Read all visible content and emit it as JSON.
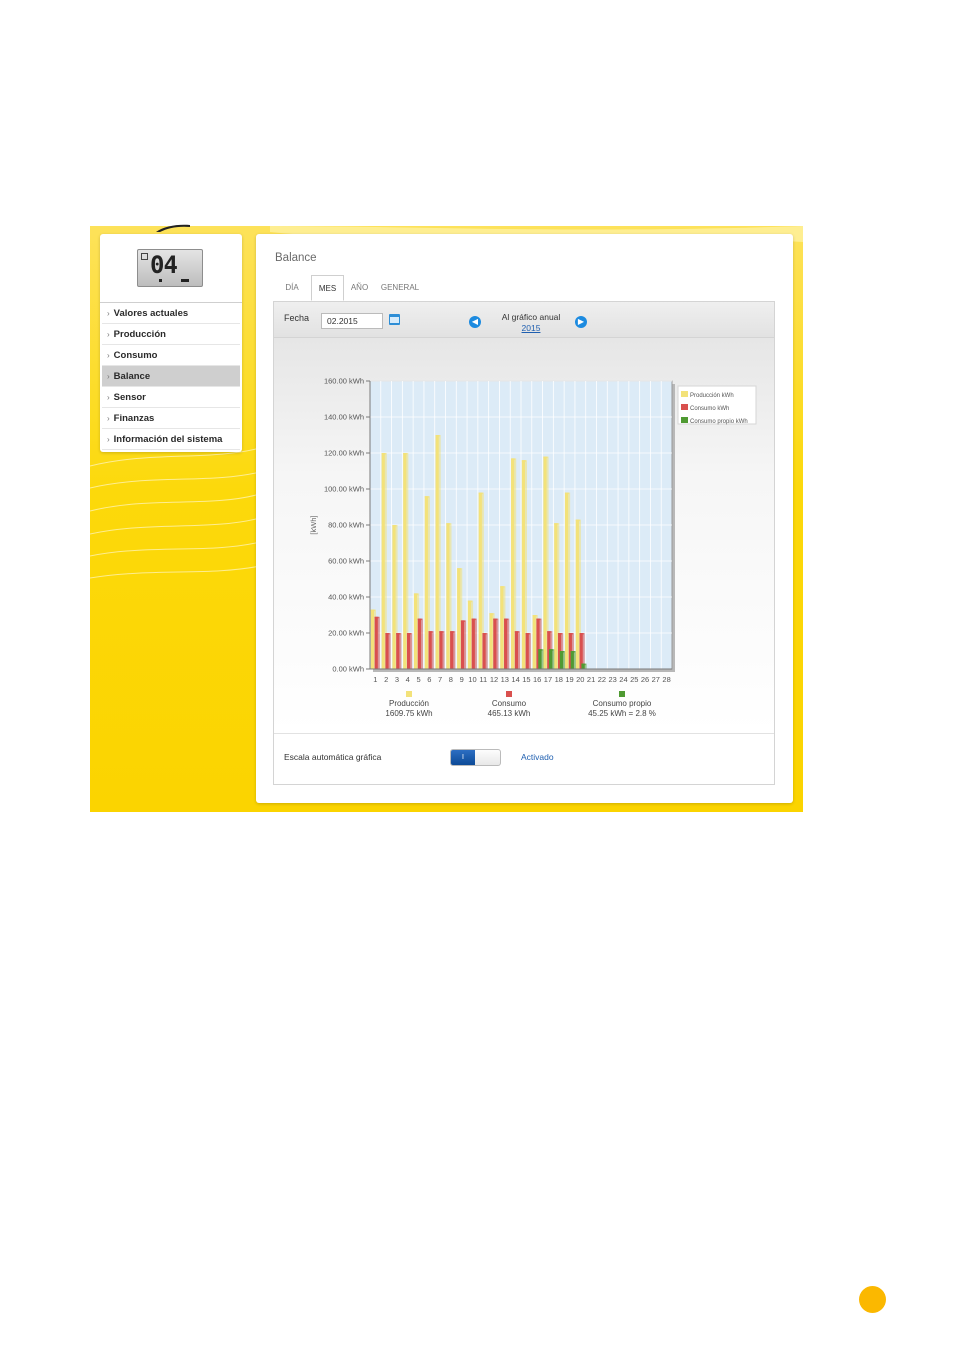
{
  "sidebar": {
    "lcd": {
      "digits": "04"
    },
    "items": [
      {
        "label": "Valores actuales"
      },
      {
        "label": "Producción"
      },
      {
        "label": "Consumo"
      },
      {
        "label": "Balance",
        "active": true
      },
      {
        "label": "Sensor"
      },
      {
        "label": "Finanzas"
      },
      {
        "label": "Información del sistema"
      }
    ]
  },
  "panel": {
    "title": "Balance",
    "tabs": [
      {
        "label": "DÍA"
      },
      {
        "label": "MES",
        "active": true
      },
      {
        "label": "AÑO"
      },
      {
        "label": "GENERAL"
      }
    ],
    "toolbar": {
      "fecha_label": "Fecha",
      "fecha_value": "02.2015",
      "annual_label": "Al gráfico anual",
      "annual_link": "2015"
    },
    "autoscale": {
      "label": "Escala automática gráfica",
      "toggle_text": "I",
      "state_label": "Activado"
    }
  },
  "colors": {
    "production": "#f3e27a",
    "consumption": "#d9504e",
    "self_consumption": "#4f9a32",
    "plot_bg": "#dcebf7",
    "frame_yellow": "#fcd90b",
    "link_blue": "#1f5fb0"
  },
  "icons": {
    "calendar": "calendar-icon",
    "prev": "arrow-left-icon",
    "next": "arrow-right-icon"
  },
  "chart_data": {
    "type": "bar",
    "ylabel": "[kWh]",
    "ylim": [
      0,
      160
    ],
    "yticks": [
      "0.00 kWh",
      "20.00 kWh",
      "40.00 kWh",
      "60.00 kWh",
      "80.00 kWh",
      "100.00 kWh",
      "120.00 kWh",
      "140.00 kWh",
      "160.00 kWh"
    ],
    "ytick_values": [
      0,
      20,
      40,
      60,
      80,
      100,
      120,
      140,
      160
    ],
    "categories": [
      "1",
      "2",
      "3",
      "4",
      "5",
      "6",
      "7",
      "8",
      "9",
      "10",
      "11",
      "12",
      "13",
      "14",
      "15",
      "16",
      "17",
      "18",
      "19",
      "20",
      "21",
      "22",
      "23",
      "24",
      "25",
      "26",
      "27",
      "28"
    ],
    "series": [
      {
        "name": "Producción kWh",
        "color": "#f3e27a",
        "values": [
          33,
          120,
          80,
          120,
          42,
          96,
          130,
          81,
          56,
          38,
          98,
          31,
          46,
          117,
          116,
          30,
          118,
          81,
          98,
          83,
          0,
          0,
          0,
          0,
          0,
          0,
          0,
          0
        ]
      },
      {
        "name": "Consumo kWh",
        "color": "#d9504e",
        "values": [
          29,
          20,
          20,
          20,
          28,
          21,
          21,
          21,
          27,
          28,
          20,
          28,
          28,
          21,
          20,
          28,
          21,
          20,
          20,
          20,
          0,
          0,
          0,
          0,
          0,
          0,
          0,
          0
        ]
      },
      {
        "name": "Consumo propio kWh",
        "color": "#4f9a32",
        "values": [
          0,
          0,
          0,
          0,
          0,
          0,
          0,
          0,
          0,
          0,
          0,
          0,
          0,
          0,
          0,
          11,
          11,
          10,
          10,
          3,
          0,
          0,
          0,
          0,
          0,
          0,
          0,
          0
        ]
      }
    ],
    "legend_position": "right",
    "grid": true,
    "totals": [
      {
        "name": "Producción",
        "value": "1609.75 kWh",
        "color": "#f3e27a"
      },
      {
        "name": "Consumo",
        "value": "465.13 kWh",
        "color": "#d9504e"
      },
      {
        "name": "Consumo propio",
        "value": "45.25 kWh = 2.8 %",
        "color": "#4f9a32"
      }
    ]
  }
}
